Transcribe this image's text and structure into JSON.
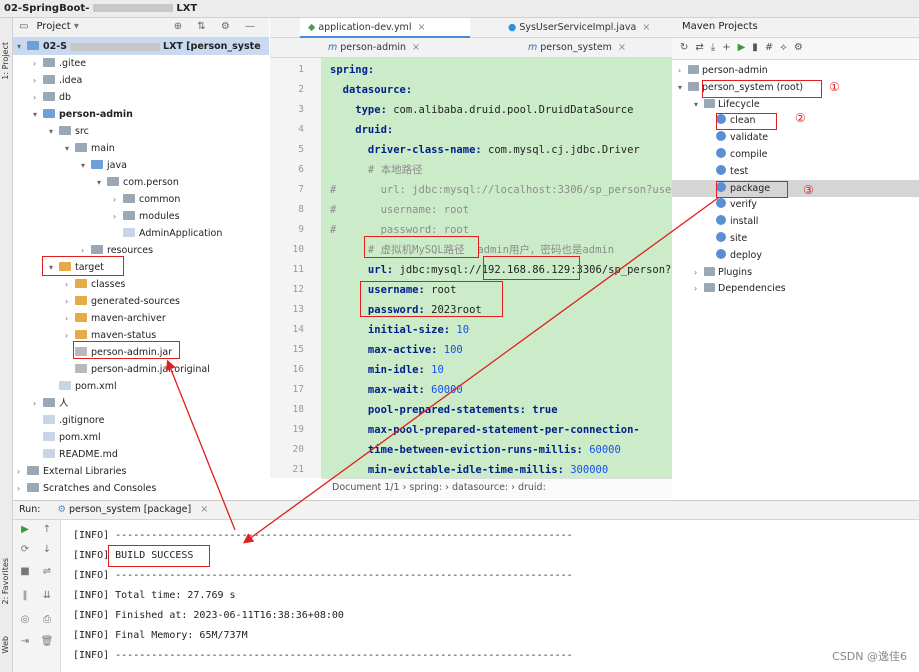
{
  "window": {
    "title": "02-SpringBoot-",
    "title_suffix": "LXT"
  },
  "left_toolbar": {
    "project": "1: Project",
    "favorites": "2: Favorites",
    "web": "Web"
  },
  "project_panel": {
    "header": "Project",
    "items": [
      {
        "label": "02-S",
        "suffix": "LXT [person_syste",
        "kind": "fold-b",
        "bold": true,
        "expanded": true
      },
      {
        "label": ".gitee",
        "kind": "fold"
      },
      {
        "label": ".idea",
        "kind": "fold"
      },
      {
        "label": "db",
        "kind": "fold"
      },
      {
        "label": "person-admin",
        "kind": "fold-b",
        "bold": true,
        "expanded": true
      },
      {
        "label": "src",
        "kind": "fold",
        "expanded": true
      },
      {
        "label": "main",
        "kind": "fold",
        "expanded": true
      },
      {
        "label": "java",
        "kind": "fold-b",
        "expanded": true
      },
      {
        "label": "com.person",
        "kind": "fold",
        "expanded": true
      },
      {
        "label": "common",
        "kind": "fold"
      },
      {
        "label": "modules",
        "kind": "fold"
      },
      {
        "label": "AdminApplication",
        "kind": "file"
      },
      {
        "label": "resources",
        "kind": "fold"
      },
      {
        "label": "target",
        "kind": "fold-o",
        "expanded": true
      },
      {
        "label": "classes",
        "kind": "fold-o"
      },
      {
        "label": "generated-sources",
        "kind": "fold-o"
      },
      {
        "label": "maven-archiver",
        "kind": "fold-o"
      },
      {
        "label": "maven-status",
        "kind": "fold-o"
      },
      {
        "label": "person-admin.jar",
        "kind": "jar"
      },
      {
        "label": "person-admin.jar.original",
        "kind": "jar"
      },
      {
        "label": "pom.xml",
        "kind": "file"
      },
      {
        "label": "人",
        "kind": "fold"
      },
      {
        "label": ".gitignore",
        "kind": "file"
      },
      {
        "label": "pom.xml",
        "kind": "file"
      },
      {
        "label": "README.md",
        "kind": "file"
      },
      {
        "label": "External Libraries",
        "kind": "fold"
      },
      {
        "label": "Scratches and Consoles",
        "kind": "fold"
      }
    ]
  },
  "editor": {
    "tabs_row1": [
      "application-dev.yml",
      "SysUserServiceImpl.java"
    ],
    "tabs_row2": [
      "person-admin",
      "person_system"
    ],
    "lines": [
      {
        "n": "1",
        "key": "spring:",
        "val": ""
      },
      {
        "n": "2",
        "key": "  datasource:",
        "val": ""
      },
      {
        "n": "3",
        "key": "    type:",
        "val": " com.alibaba.druid.pool.DruidDataSource"
      },
      {
        "n": "4",
        "key": "    druid:",
        "val": ""
      },
      {
        "n": "5",
        "key": "      driver-class-name:",
        "val": " com.mysql.cj.jdbc.Driver"
      },
      {
        "n": "6",
        "key": "",
        "val": "      # 本地路径",
        "comment": true
      },
      {
        "n": "7",
        "key": "",
        "val": "#       url: jdbc:mysql://localhost:3306/sp_person?usel",
        "comment": true
      },
      {
        "n": "8",
        "key": "",
        "val": "#       username: root",
        "comment": true
      },
      {
        "n": "9",
        "key": "",
        "val": "#       password: root",
        "comment": true
      },
      {
        "n": "10",
        "key": "",
        "val": "      # 虚拟机MySQL路径  admin用户，密码也是admin",
        "comment": true
      },
      {
        "n": "11",
        "key": "      url:",
        "val": " jdbc:mysql://192.168.86.129:3306/sp_person?"
      },
      {
        "n": "12",
        "key": "      username:",
        "val": " root"
      },
      {
        "n": "13",
        "key": "      password:",
        "val": " 2023root"
      },
      {
        "n": "14",
        "key": "      initial-size:",
        "val": " 10",
        "num": true
      },
      {
        "n": "15",
        "key": "      max-active:",
        "val": " 100",
        "num": true
      },
      {
        "n": "16",
        "key": "      min-idle:",
        "val": " 10",
        "num": true
      },
      {
        "n": "17",
        "key": "      max-wait:",
        "val": " 60000",
        "num": true
      },
      {
        "n": "18",
        "key": "      pool-prepared-statements:",
        "val": " true",
        "kw": true
      },
      {
        "n": "19",
        "key": "      max-pool-prepared-statement-per-connection-",
        "val": ""
      },
      {
        "n": "20",
        "key": "      time-between-eviction-runs-millis:",
        "val": " 60000",
        "num": true
      },
      {
        "n": "21",
        "key": "      min-evictable-idle-time-millis:",
        "val": " 300000",
        "num": true
      }
    ],
    "breadcrumb": "Document 1/1  ›  spring:  ›  datasource:  ›  druid:"
  },
  "maven": {
    "header": "Maven Projects",
    "items": [
      {
        "label": "person-admin",
        "level": 0,
        "kind": "proj"
      },
      {
        "label": "person_system (root)",
        "level": 0,
        "kind": "proj",
        "expanded": true
      },
      {
        "label": "Lifecycle",
        "level": 1,
        "kind": "fold",
        "expanded": true
      },
      {
        "label": "clean",
        "level": 2,
        "kind": "gear"
      },
      {
        "label": "validate",
        "level": 2,
        "kind": "gear"
      },
      {
        "label": "compile",
        "level": 2,
        "kind": "gear"
      },
      {
        "label": "test",
        "level": 2,
        "kind": "gear"
      },
      {
        "label": "package",
        "level": 2,
        "kind": "gear",
        "selected": true
      },
      {
        "label": "verify",
        "level": 2,
        "kind": "gear"
      },
      {
        "label": "install",
        "level": 2,
        "kind": "gear"
      },
      {
        "label": "site",
        "level": 2,
        "kind": "gear"
      },
      {
        "label": "deploy",
        "level": 2,
        "kind": "gear"
      },
      {
        "label": "Plugins",
        "level": 1,
        "kind": "fold"
      },
      {
        "label": "Dependencies",
        "level": 1,
        "kind": "fold"
      }
    ],
    "annotations": [
      "①",
      "②",
      "③"
    ]
  },
  "run": {
    "label": "Run:",
    "tab": "person_system [package]",
    "lines": [
      "[INFO] ----------------------------------------------------------------------------",
      "[INFO] BUILD SUCCESS",
      "[INFO] ----------------------------------------------------------------------------",
      "[INFO] Total time: 27.769 s",
      "[INFO] Finished at: 2023-06-11T16:38:36+08:00",
      "[INFO] Final Memory: 65M/737M",
      "[INFO] ----------------------------------------------------------------------------"
    ]
  },
  "watermark": "CSDN @逸佳6",
  "colors": {
    "annotation_red": "#e01e1e",
    "editor_bg": "#ccecc9",
    "accent": "#4a88d8"
  }
}
